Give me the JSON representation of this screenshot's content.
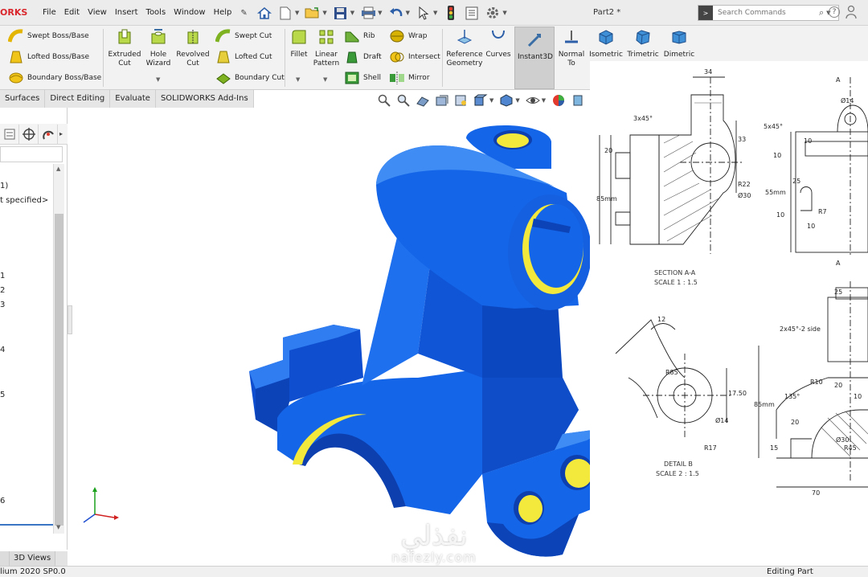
{
  "app": {
    "logo_text": "ORKS",
    "document_title": "Part2 *",
    "colors": {
      "accent": "#d9262c",
      "part": "#1565e8",
      "hole_inner": "#f3e83c",
      "ribbon_bg": "#f2f2f2"
    }
  },
  "menu": [
    "File",
    "Edit",
    "View",
    "Insert",
    "Tools",
    "Window",
    "Help"
  ],
  "quick_access_icons": [
    "home-icon",
    "new-document-icon",
    "open-icon",
    "save-icon",
    "print-icon",
    "undo-icon",
    "select-icon",
    "rebuild-icon",
    "file-properties-icon",
    "options-icon"
  ],
  "search": {
    "prefix": ">",
    "placeholder": "Search Commands"
  },
  "ribbon": {
    "boss_features": [
      "Swept Boss/Base",
      "Lofted Boss/Base",
      "Boundary Boss/Base"
    ],
    "extruded_cut": "Extruded\nCut",
    "hole_wizard": "Hole\nWizard",
    "revolved_cut": "Revolved\nCut",
    "cut_features": [
      "Swept Cut",
      "Lofted Cut",
      "Boundary Cut"
    ],
    "fillet": "Fillet",
    "linear_pattern": "Linear\nPattern",
    "features_col1": [
      "Rib",
      "Draft",
      "Shell"
    ],
    "features_col2": [
      "Wrap",
      "Intersect",
      "Mirror"
    ],
    "reference_geometry": "Reference\nGeometry",
    "curves": "Curves",
    "instant3d": "Instant3D",
    "views": [
      "Normal\nTo",
      "Isometric",
      "Trimetric",
      "Dimetric"
    ]
  },
  "tabs": [
    "Surfaces",
    "Direct Editing",
    "Evaluate",
    "SOLIDWORKS Add-Ins"
  ],
  "feature_tree": {
    "lines": [
      "1)",
      "t specified>",
      "1",
      "2",
      "3",
      "4",
      "5",
      "6"
    ]
  },
  "bottom_tabs": [
    "",
    "3D Views"
  ],
  "status": {
    "left": "lium 2020 SP0.0",
    "right": "Editing Part"
  },
  "drawing": {
    "section_label": "SECTION A-A",
    "section_scale": "SCALE 1 : 1.5",
    "detail_label": "DETAIL B",
    "detail_scale": "SCALE 2 : 1.5",
    "dims": {
      "d34": "34",
      "d3x45": "3x45°",
      "d20a": "20",
      "d33": "33",
      "d85": "85mm",
      "dR22": "R22",
      "dD30": "Ø30",
      "dA1": "A",
      "dA2": "A",
      "dD14": "Ø14",
      "d5x45": "5x45°",
      "d10a": "10",
      "d10b": "10",
      "d55": "55mm",
      "d25a": "25",
      "d10c": "10",
      "dR7": "R7",
      "d10d": "10",
      "d12": "12",
      "dR85": "R85",
      "d1750": "17.50",
      "dD14b": "Ø14",
      "dR17": "R17",
      "d25b": "25",
      "d2x45": "2x45°-2 side",
      "d85b": "85mm",
      "dR10": "R10",
      "d135": "135°",
      "d20b": "20",
      "d10e": "10",
      "d20c": "20",
      "d15": "15",
      "d70": "70",
      "dD30b": "Ø30",
      "dR45": "R45"
    }
  },
  "watermark": {
    "arabic": "نفذلي",
    "latin": "nafezly.com"
  }
}
